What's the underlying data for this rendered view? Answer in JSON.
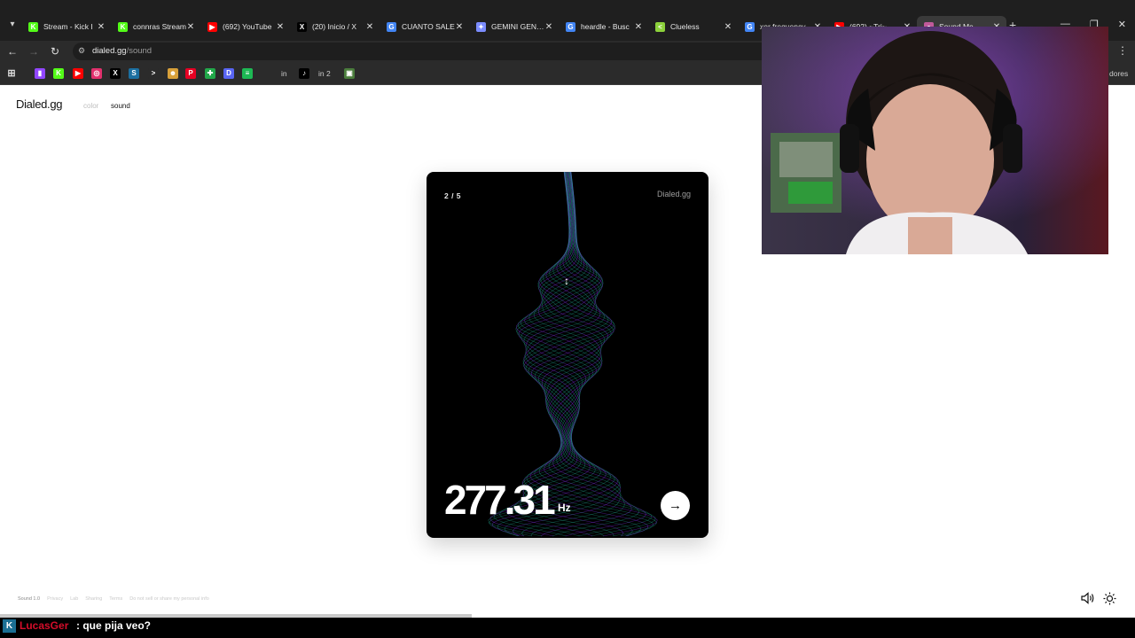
{
  "browser": {
    "tabs": [
      {
        "title": "Stream - Kick I",
        "icon": "kick-icon",
        "color": "#53fc18",
        "letter": "K"
      },
      {
        "title": "connras Stream",
        "icon": "kick-icon",
        "color": "#53fc18",
        "letter": "K"
      },
      {
        "title": "(692) YouTube",
        "icon": "youtube-icon",
        "color": "#ff0000",
        "letter": "▶"
      },
      {
        "title": "(20) Inicio / X",
        "icon": "x-icon",
        "color": "#000000",
        "letter": "X"
      },
      {
        "title": "CUANTO SALE",
        "icon": "google-icon",
        "color": "#4285f4",
        "letter": "G"
      },
      {
        "title": "GEMINI GENER",
        "icon": "gemini-icon",
        "color": "#7b8cff",
        "letter": "✦"
      },
      {
        "title": "heardle - Busc",
        "icon": "google-icon",
        "color": "#4285f4",
        "letter": "G"
      },
      {
        "title": "Clueless",
        "icon": "clueless-icon",
        "color": "#8cd13b",
        "letter": "<"
      },
      {
        "title": "xor frequency",
        "icon": "google-icon",
        "color": "#4285f4",
        "letter": "G"
      },
      {
        "title": "(692) ~Tri~",
        "icon": "youtube-icon",
        "color": "#ff0000",
        "letter": "▶"
      },
      {
        "title": "Sound Me",
        "icon": "dialed-icon",
        "color": "#c05a9a",
        "letter": "●",
        "active": true
      }
    ],
    "url_host": "dialed.gg",
    "url_path": "/sound",
    "bookmarks": [
      {
        "icon": "twitch-icon",
        "color": "#9146ff",
        "letter": "▮"
      },
      {
        "icon": "kick-icon",
        "color": "#53fc18",
        "letter": "K"
      },
      {
        "icon": "youtube-icon",
        "color": "#ff0000",
        "letter": "▶"
      },
      {
        "icon": "instagram-icon",
        "color": "#e1306c",
        "letter": "◎"
      },
      {
        "icon": "x-icon",
        "color": "#000000",
        "letter": "X"
      },
      {
        "icon": "steam-icon",
        "color": "#1b6fa0",
        "letter": "S"
      },
      {
        "icon": "prompt-icon",
        "color": "#2b2b2b",
        "letter": ">"
      },
      {
        "icon": "bot-icon",
        "color": "#d8a03a",
        "letter": "☻"
      },
      {
        "icon": "pinterest-icon",
        "color": "#e60023",
        "letter": "P"
      },
      {
        "icon": "xbox-icon",
        "color": "#22a84a",
        "letter": "✚"
      },
      {
        "icon": "discord-icon",
        "color": "#5865f2",
        "letter": "D"
      },
      {
        "icon": "spotify-icon",
        "color": "#1db954",
        "letter": "≡"
      }
    ],
    "bookmark_labels": [
      "in",
      "in 2"
    ],
    "bookmark_right_label": "dores"
  },
  "page": {
    "brand": "Dialed.gg",
    "nav": [
      {
        "label": "color",
        "active": false
      },
      {
        "label": "sound",
        "active": true
      }
    ],
    "card": {
      "counter": "2 / 5",
      "brand": "Dialed.gg",
      "frequency": "277.31",
      "unit": "Hz",
      "next_symbol": "→"
    },
    "footer": [
      "Sound 1.0",
      "Privacy",
      "Lab",
      "Sharing",
      "Terms",
      "Do not sell or share my personal info"
    ]
  },
  "chat": {
    "icon_letter": "K",
    "username": "LucasGer",
    "message": ": que pija veo?"
  },
  "colors": {
    "wave_cyan": "#2fe0c0",
    "wave_purple": "#7a2bd8",
    "chat_user": "#d40d2a"
  }
}
